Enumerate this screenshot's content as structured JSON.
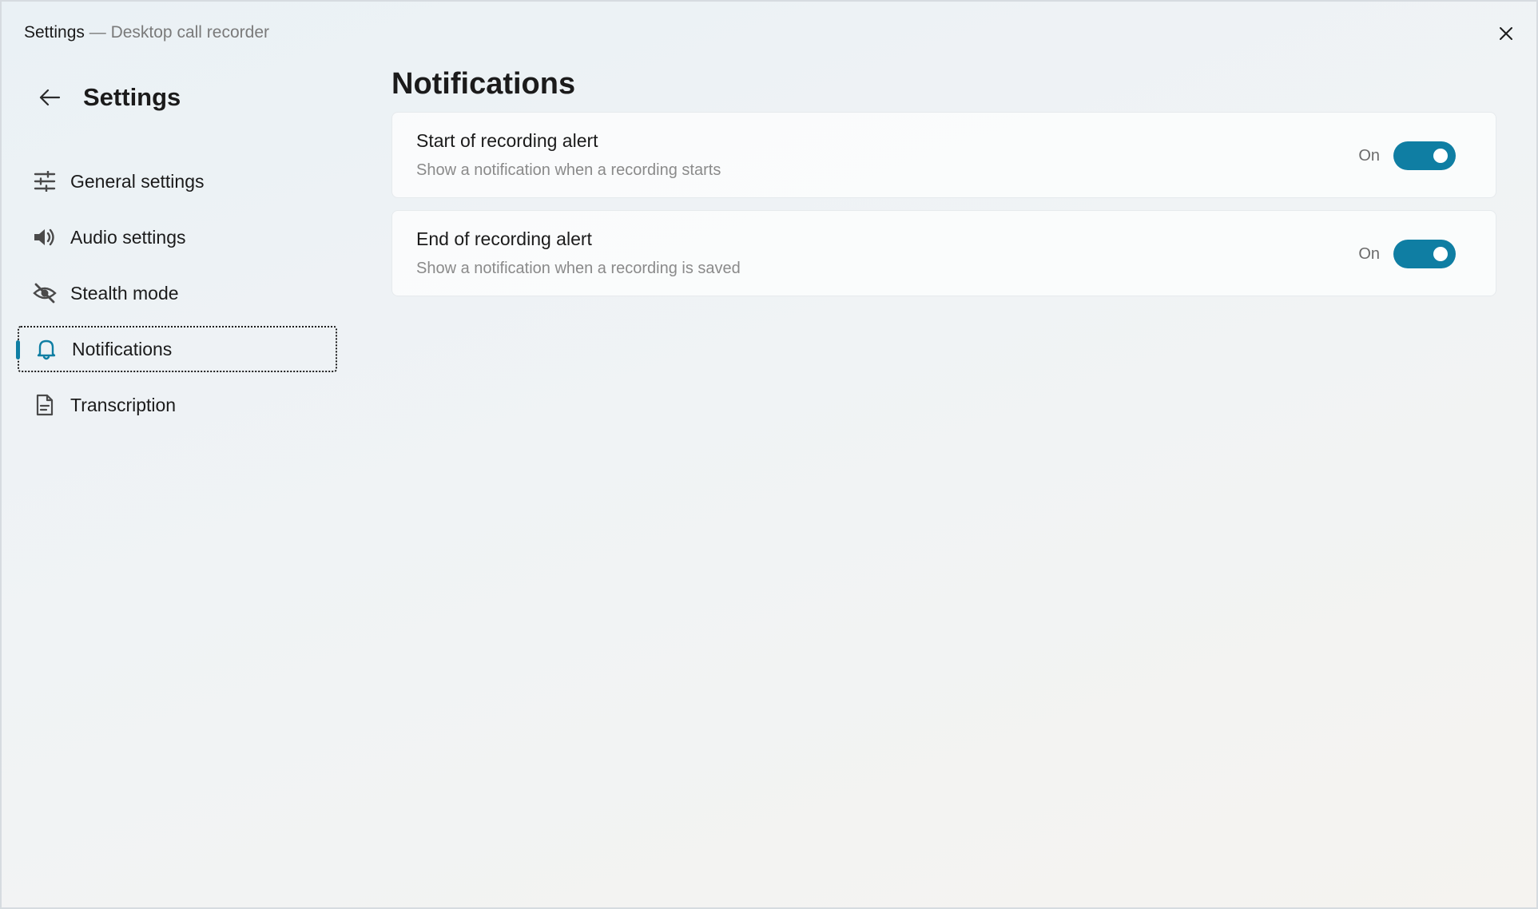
{
  "window": {
    "title": "Settings",
    "separator": "—",
    "subtitle": "Desktop call recorder"
  },
  "sidebar": {
    "title": "Settings",
    "items": [
      {
        "label": "General settings",
        "icon": "sliders-icon"
      },
      {
        "label": "Audio settings",
        "icon": "speaker-icon"
      },
      {
        "label": "Stealth mode",
        "icon": "eye-off-icon"
      },
      {
        "label": "Notifications",
        "icon": "bell-icon",
        "selected": true
      },
      {
        "label": "Transcription",
        "icon": "document-icon"
      }
    ]
  },
  "main": {
    "title": "Notifications",
    "settings": [
      {
        "title": "Start of recording alert",
        "description": "Show a notification when a recording starts",
        "state": "On",
        "enabled": true
      },
      {
        "title": "End of recording alert",
        "description": "Show a notification when a recording is saved",
        "state": "On",
        "enabled": true
      }
    ]
  },
  "colors": {
    "accent": "#0f7ea3",
    "text": "#1b1b1b",
    "secondary_text": "#8a8a8a"
  }
}
